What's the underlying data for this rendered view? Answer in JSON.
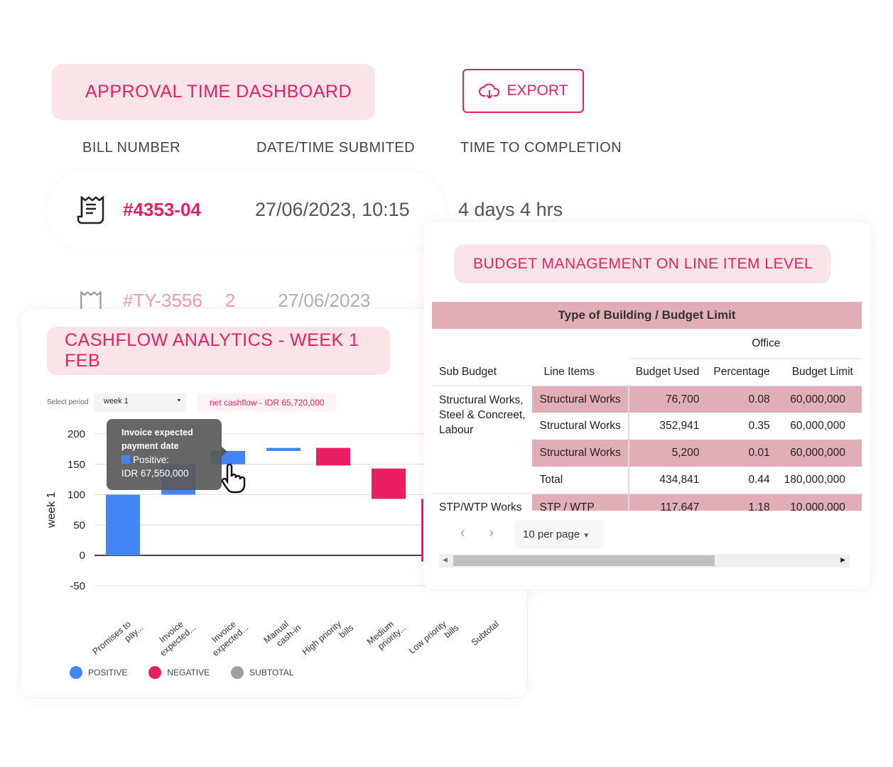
{
  "approval": {
    "title": "APPROVAL TIME DASHBOARD",
    "export_label": "EXPORT",
    "columns": [
      "BILL NUMBER",
      "DATE/TIME SUBMITED",
      "TIME TO COMPLETION"
    ],
    "rows": [
      {
        "bill": "#4353-04",
        "date": "27/06/2023, 10:15",
        "time": "4 days 4 hrs"
      },
      {
        "bill": "#TY-3556",
        "extra": "2",
        "date": "27/06/2023",
        "time": ""
      }
    ]
  },
  "cashflow": {
    "title": "CASHFLOW ANALYTICS - WEEK 1 FEB",
    "select_label": "Select period",
    "select_value": "week 1",
    "net_cashflow": "net cashflow - IDR 65,720,000",
    "tooltip": {
      "title_line1": "Invoice expected",
      "title_line2": "payment date",
      "series": "Positive:",
      "value": "IDR 67,550,000"
    },
    "legend": [
      {
        "label": "POSITIVE",
        "color": "#4285f4"
      },
      {
        "label": "NEGATIVE",
        "color": "#e91e63"
      },
      {
        "label": "SUBTOTAL",
        "color": "#9e9e9e"
      }
    ]
  },
  "chart_data": {
    "type": "waterfall",
    "ylabel": "week 1",
    "ylim": [
      -50,
      200
    ],
    "yticks": [
      200,
      150,
      100,
      50,
      0,
      -50
    ],
    "grid": true,
    "legend_placement": "bottom-left",
    "categories": [
      [
        "Promises to",
        "pay..."
      ],
      [
        "Invoice",
        "expected..."
      ],
      [
        "Invoice",
        "expected..."
      ],
      [
        "Manual",
        "cash-in"
      ],
      [
        "High priority",
        "bills"
      ],
      [
        "Medium",
        "priority..."
      ],
      [
        "Low priority",
        "bills"
      ],
      [
        "Subtotal"
      ]
    ],
    "bars": [
      {
        "start": 0,
        "end": 100,
        "kind": "positive"
      },
      {
        "start": 100,
        "end": 150,
        "kind": "positive"
      },
      {
        "start": 150,
        "end": 172,
        "kind": "positive"
      },
      {
        "start": 172,
        "end": 177,
        "kind": "positive"
      },
      {
        "start": 177,
        "end": 148,
        "kind": "negative"
      },
      {
        "start": 143,
        "end": 93,
        "kind": "negative"
      },
      {
        "start": 93,
        "end": -10,
        "kind": "negative"
      }
    ]
  },
  "budget": {
    "title": "BUDGET MANAGEMENT ON LINE ITEM LEVEL",
    "group_header": "Type of Building / Budget Limit",
    "building": "Office",
    "headers": [
      "Sub Budget",
      "Line Items",
      "Budget Used",
      "Percentage",
      "Budget Limit"
    ],
    "sub1": [
      "Structural Works,",
      "Steel & Concreet,",
      "Labour"
    ],
    "rows": [
      [
        "Structural Works",
        "76,700",
        "0.08",
        "60,000,000"
      ],
      [
        "Structural Works",
        "352,941",
        "0.35",
        "60,000,000"
      ],
      [
        "Structural Works",
        "5,200",
        "0.01",
        "60,000,000"
      ]
    ],
    "total": [
      "Total",
      "434,841",
      "0.44",
      "180,000,000"
    ],
    "next": [
      "STP/WTP Works",
      "STP / WTP",
      "117,647",
      "1.18",
      "10,000,000"
    ],
    "per_page": "10 per page"
  }
}
